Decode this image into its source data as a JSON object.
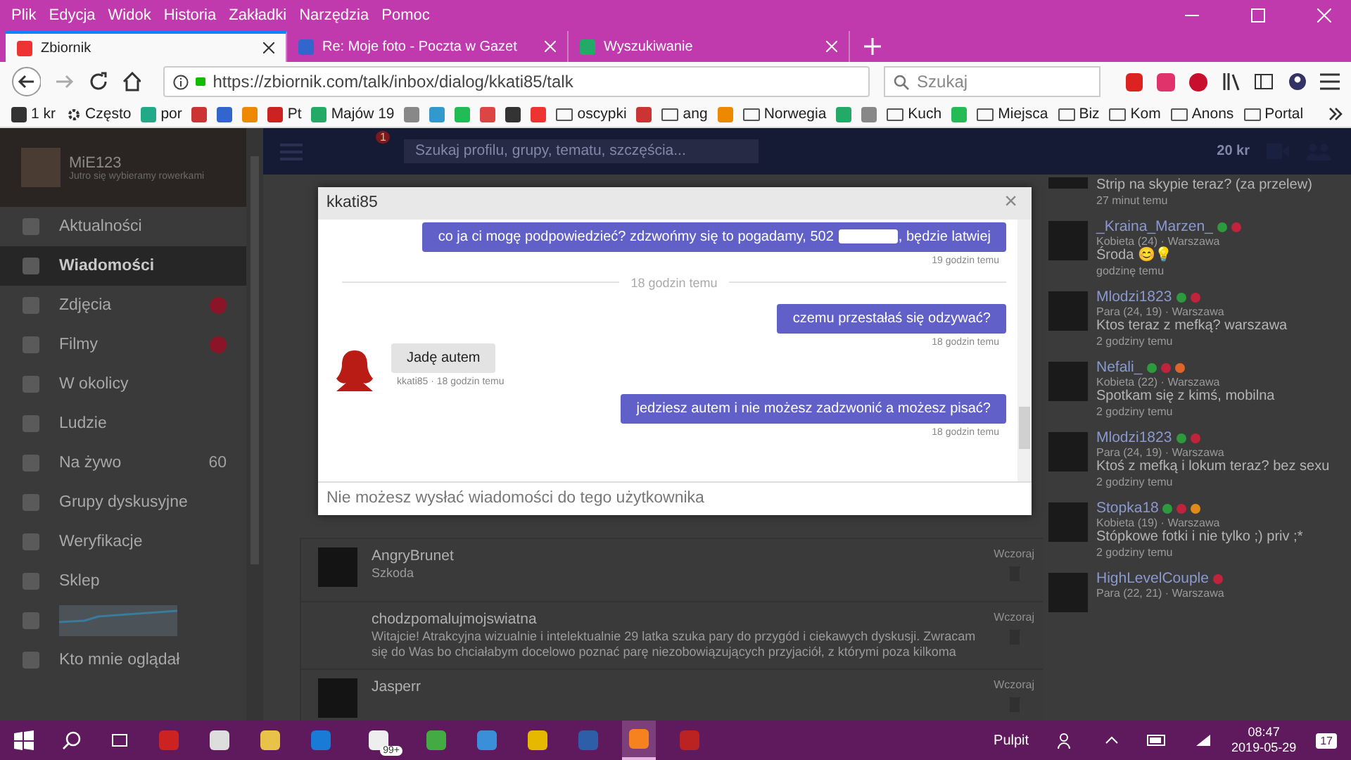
{
  "browser": {
    "menu": [
      "Plik",
      "Edycja",
      "Widok",
      "Historia",
      "Zakładki",
      "Narzędzia",
      "Pomoc"
    ],
    "tabs": [
      {
        "title": "Zbiornik",
        "selected": true
      },
      {
        "title": "Re: Moje foto - Poczta w Gazet",
        "selected": false
      },
      {
        "title": "Wyszukiwanie",
        "selected": false
      }
    ],
    "url": "https://zbiornik.com/talk/inbox/dialog/kkati85/talk",
    "search": {
      "placeholder": "Szukaj"
    },
    "bookmarks": [
      {
        "kind": "site",
        "label": "1 kr"
      },
      {
        "kind": "gear",
        "label": "Często"
      },
      {
        "kind": "site",
        "label": "por"
      },
      {
        "kind": "site"
      },
      {
        "kind": "site"
      },
      {
        "kind": "site"
      },
      {
        "kind": "site",
        "label": "Pt"
      },
      {
        "kind": "site",
        "label": "Majów 19"
      },
      {
        "kind": "site"
      },
      {
        "kind": "site"
      },
      {
        "kind": "site"
      },
      {
        "kind": "site"
      },
      {
        "kind": "site"
      },
      {
        "kind": "site"
      },
      {
        "kind": "folder",
        "label": "oscypki"
      },
      {
        "kind": "site"
      },
      {
        "kind": "folder",
        "label": "ang"
      },
      {
        "kind": "site"
      },
      {
        "kind": "folder",
        "label": "Norwegia"
      },
      {
        "kind": "site"
      },
      {
        "kind": "site"
      },
      {
        "kind": "folder",
        "label": "Kuch"
      },
      {
        "kind": "site"
      },
      {
        "kind": "folder",
        "label": "Miejsca"
      },
      {
        "kind": "folder",
        "label": "Biz"
      },
      {
        "kind": "folder",
        "label": "Kom"
      },
      {
        "kind": "folder",
        "label": "Anons"
      },
      {
        "kind": "folder",
        "label": "Portal"
      }
    ]
  },
  "profile": {
    "name": "MiE123",
    "status": "Jutro się wybieramy rowerkami"
  },
  "nav": [
    {
      "label": "Aktualności",
      "selected": false
    },
    {
      "label": "Wiadomości",
      "selected": true
    },
    {
      "label": "Zdjęcia",
      "selected": false,
      "plus": true
    },
    {
      "label": "Filmy",
      "selected": false,
      "plus": true
    },
    {
      "label": "W okolicy",
      "selected": false
    },
    {
      "label": "Ludzie",
      "selected": false
    },
    {
      "label": "Na żywo",
      "selected": false,
      "count": "60"
    },
    {
      "label": "Grupy dyskusyjne",
      "selected": false
    },
    {
      "label": "Weryfikacje",
      "selected": false
    },
    {
      "label": "Sklep",
      "selected": false
    },
    {
      "kind": "chart",
      "selected": false
    },
    {
      "label": "Kto mnie oglądał",
      "selected": false
    }
  ],
  "topbar": {
    "notifications": "1",
    "search_placeholder": "Szukaj profilu, grupy, tematu, szczęścia...",
    "credits": "20 kr"
  },
  "conversations": [
    {
      "name": "AngryBrunet",
      "text": "Szkoda",
      "time": "Wczoraj",
      "avatar": true
    },
    {
      "name": "chodzpomalujmojswiatna",
      "text": "Witajcie! Atrakcyjna wizualnie i intelektualnie 29 latka szuka pary do przygód i ciekawych dyskusji. Zwracam się do Was bo chciałabym docelowo poznać parę niezobowiązujących przyjaciół, z którymi poza kilkoma",
      "time": "Wczoraj",
      "avatar": false
    },
    {
      "name": "Jasperr",
      "time": "Wczoraj",
      "avatar": true
    }
  ],
  "posts": [
    {
      "text": "Strip na skypie teraz? (za przelew)",
      "time": "27 minut temu"
    },
    {
      "name": "_Kraina_Marzen_",
      "badges": [
        {
          "color": "#2e9a3e"
        },
        {
          "color": "#c0243c"
        }
      ],
      "meta": "Kobieta (24) · Warszawa",
      "text": "Środa 😊💡",
      "time": "godzinę temu"
    },
    {
      "name": "Mlodzi1823",
      "badges": [
        {
          "color": "#2e9a3e"
        },
        {
          "color": "#c0243c"
        }
      ],
      "meta": "Para (24, 19) · Warszawa",
      "text": "Ktos teraz z mefką? warszawa",
      "time": "2 godziny temu"
    },
    {
      "name": "Nefali_",
      "badges": [
        {
          "color": "#2e9a3e"
        },
        {
          "color": "#c0243c"
        },
        {
          "color": "#e0642a"
        }
      ],
      "meta": "Kobieta (22) · Warszawa",
      "text": "Spotkam się z kimś, mobilna",
      "time": "2 godziny temu"
    },
    {
      "name": "Mlodzi1823",
      "badges": [
        {
          "color": "#2e9a3e"
        },
        {
          "color": "#c0243c"
        }
      ],
      "meta": "Para (24, 19) · Warszawa",
      "text": "Ktoś z mefką i lokum teraz? bez sexu",
      "time": "2 godziny temu"
    },
    {
      "name": "Stopka18",
      "badges": [
        {
          "color": "#2e9a3e"
        },
        {
          "color": "#c0243c"
        },
        {
          "color": "#e08a1a"
        }
      ],
      "meta": "Kobieta (19) · Warszawa",
      "text": "Stópkowe fotki i nie tylko ;) priv ;*",
      "time": "2 godziny temu"
    },
    {
      "name": "HighLevelCouple",
      "badges": [
        {
          "color": "#c0243c"
        }
      ],
      "meta": "Para (22, 21) · Warszawa"
    }
  ],
  "dialog": {
    "title": "kkati85",
    "close": "×",
    "messages": [
      {
        "kind": "sent",
        "text": "co ja ci mogę podpowiedzieć? zdzwońmy się to pogadamy, 502",
        "redacted": true,
        "text_after": ", będzie latwiej",
        "time": "19 godzin temu"
      },
      {
        "kind": "divider",
        "text": "18 godzin temu"
      },
      {
        "kind": "sent",
        "text": "czemu przestałaś się odzywać?",
        "time": "18 godzin temu"
      },
      {
        "kind": "received",
        "text": "Jadę autem",
        "time": "kkati85 · 18 godzin temu"
      },
      {
        "kind": "sent",
        "text": "jedziesz autem i nie możesz zadzwonić a możesz pisać?",
        "time": "18 godzin temu"
      }
    ],
    "footer": "Nie możesz wysłać wiadomości do tego użytkownika"
  },
  "taskbar": {
    "apps": [
      {
        "active": false
      },
      {
        "active": false
      },
      {
        "active": false
      },
      {
        "active": false
      },
      {
        "active": false,
        "badge": "99+"
      },
      {
        "active": false
      },
      {
        "active": false
      },
      {
        "active": false
      },
      {
        "active": false
      },
      {
        "active": true
      },
      {
        "active": false
      }
    ],
    "desktop": "Pulpit",
    "time": "08:47",
    "date": "2019-05-29",
    "notifications": "17"
  }
}
